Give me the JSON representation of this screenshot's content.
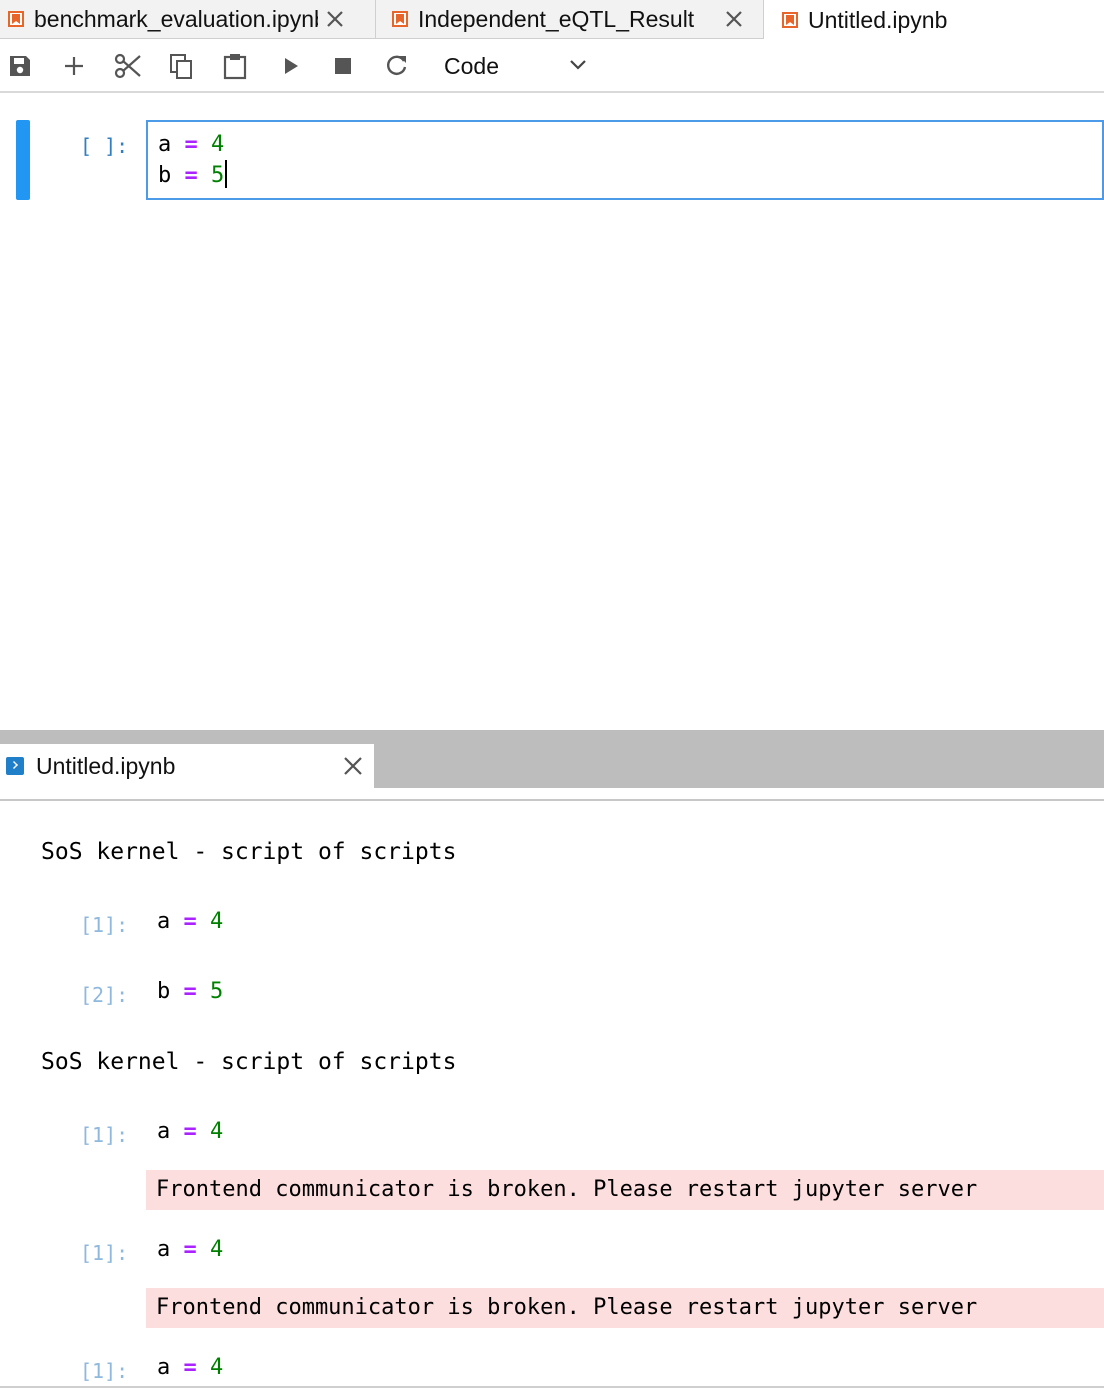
{
  "tabs": [
    {
      "label": "benchmark_evaluation.ipynb",
      "active": false
    },
    {
      "label": "Independent_eQTL_Result",
      "active": false
    },
    {
      "label": "Untitled.ipynb",
      "active": true
    }
  ],
  "toolbar": {
    "buttons": [
      "save-icon",
      "add-icon",
      "cut-icon",
      "copy-icon",
      "paste-icon",
      "run-icon",
      "stop-icon",
      "restart-icon"
    ],
    "cell_type": "Code"
  },
  "cell": {
    "prompt": "[ ]:",
    "lines": [
      {
        "var": "a",
        "op": "=",
        "num": "4"
      },
      {
        "var": "b",
        "op": "=",
        "num": "5"
      }
    ]
  },
  "panel": {
    "tab_label": "Untitled.ipynb",
    "banner1": "SoS kernel - script of scripts",
    "banner2": "SoS kernel - script of scripts",
    "entries": [
      {
        "prompt": "[1]:",
        "var": "a",
        "op": "=",
        "num": "4"
      },
      {
        "prompt": "[2]:",
        "var": "b",
        "op": "=",
        "num": "5"
      },
      {
        "prompt": "[1]:",
        "var": "a",
        "op": "=",
        "num": "4"
      },
      {
        "prompt": "[1]:",
        "var": "a",
        "op": "=",
        "num": "4"
      },
      {
        "prompt": "[1]:",
        "var": "a",
        "op": "=",
        "num": "4"
      }
    ],
    "errors": [
      "Frontend communicator is broken. Please restart jupyter server",
      "Frontend communicator is broken. Please restart jupyter server"
    ]
  },
  "colors": {
    "accent": "#2196f3",
    "notebook_icon": "#e8662a",
    "operator": "#aa22ff",
    "number": "#008000",
    "error_bg": "#fddede"
  }
}
